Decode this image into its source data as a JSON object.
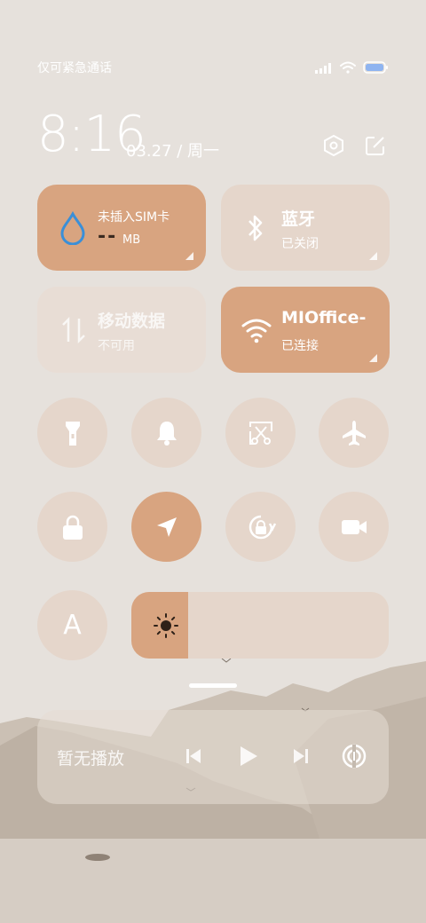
{
  "status_bar": {
    "carrier_text": "仅可紧急通话",
    "signal_icon": "signal-icon",
    "wifi_icon": "wifi-icon",
    "battery_icon": "battery-icon"
  },
  "header": {
    "time": "8:16",
    "date": "03.27 / 周一",
    "settings_icon": "settings-hexagon-icon",
    "edit_icon": "edit-icon"
  },
  "tiles": {
    "data_usage": {
      "title": "未插入SIM卡",
      "value": "--",
      "unit": "MB",
      "icon": "water-drop-icon",
      "state": "on"
    },
    "bluetooth": {
      "title": "蓝牙",
      "sub": "已关闭",
      "icon": "bluetooth-icon",
      "state": "off"
    },
    "mobile_data": {
      "title": "移动数据",
      "sub": "不可用",
      "icon": "mobile-data-icon",
      "state": "disabled"
    },
    "wifi": {
      "title": "MIOffice-",
      "sub": "已连接",
      "icon": "wifi-icon",
      "state": "on"
    }
  },
  "toggles": [
    {
      "name": "flashlight",
      "icon": "flashlight-icon",
      "active": false
    },
    {
      "name": "sound",
      "icon": "bell-icon",
      "active": false
    },
    {
      "name": "screenshot",
      "icon": "screenshot-scissors-icon",
      "active": false
    },
    {
      "name": "airplane",
      "icon": "airplane-icon",
      "active": false
    },
    {
      "name": "lock-screen",
      "icon": "lock-icon",
      "active": false
    },
    {
      "name": "location",
      "icon": "location-arrow-icon",
      "active": true
    },
    {
      "name": "auto-rotate",
      "icon": "rotate-lock-icon",
      "active": false
    },
    {
      "name": "screen-record",
      "icon": "video-camera-icon",
      "active": false
    }
  ],
  "auto_brightness": {
    "label": "A"
  },
  "brightness": {
    "level": 0.22,
    "icon": "sun-icon"
  },
  "media": {
    "label": "暂无播放",
    "prev_icon": "previous-icon",
    "play_icon": "play-icon",
    "next_icon": "next-icon",
    "output_icon": "audio-output-icon"
  },
  "colors": {
    "background": "#e6e1dc",
    "accent": "#d8a480",
    "tile_off": "#e5d6cb",
    "drop_blue": "#3a8fd8"
  }
}
